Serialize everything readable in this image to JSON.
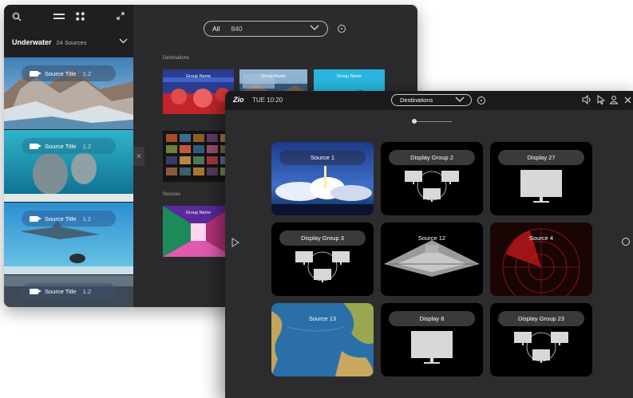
{
  "back_window": {
    "group": {
      "name": "Underwater",
      "count": "24 Sources"
    },
    "sources": [
      {
        "title": "Source Title",
        "num": "1.2"
      },
      {
        "title": "Source Title",
        "num": "1.2"
      },
      {
        "title": "Source Title",
        "num": "1.2"
      },
      {
        "title": "Source Title",
        "num": "1.2"
      }
    ],
    "collapse_glyph": "✕",
    "filter": {
      "label": "All",
      "value": "840"
    },
    "destinations_label": "Destinations",
    "sources_label": "Sources",
    "dest_thumbs": [
      {
        "name": "Group Name"
      },
      {
        "name": "Group Name"
      },
      {
        "name": "Group Name"
      }
    ],
    "source_thumb": {
      "name": "Group Name"
    }
  },
  "front_window": {
    "logo": "Zio",
    "clock": "TUE  10:20",
    "dest_select": "Destinations",
    "tiles": [
      {
        "label": "Source 1",
        "kind": "sky"
      },
      {
        "label": "Display Group 2",
        "kind": "group"
      },
      {
        "label": "Display 27",
        "kind": "display"
      },
      {
        "label": "Display Group 3",
        "kind": "group"
      },
      {
        "label": "Source 12",
        "kind": "ship"
      },
      {
        "label": "Source 4",
        "kind": "radar"
      },
      {
        "label": "Source 13",
        "kind": "map"
      },
      {
        "label": "Display 8",
        "kind": "display"
      },
      {
        "label": "Display Group 23",
        "kind": "group"
      }
    ]
  },
  "icons": [
    "search-icon",
    "list-view-icon",
    "grid-view-icon",
    "expand-icon",
    "chevron-down-icon",
    "video-camera-icon",
    "info-icon",
    "volume-icon",
    "pointer-icon",
    "user-icon",
    "close-icon",
    "play-left-icon",
    "circle-right-icon"
  ],
  "colors": {
    "panel": "#2b2b2d",
    "sidebar": "#1f1f21",
    "tile_bg": "#000000",
    "label_pill": "#3a3a3d",
    "radar_red": "#c0191b"
  }
}
